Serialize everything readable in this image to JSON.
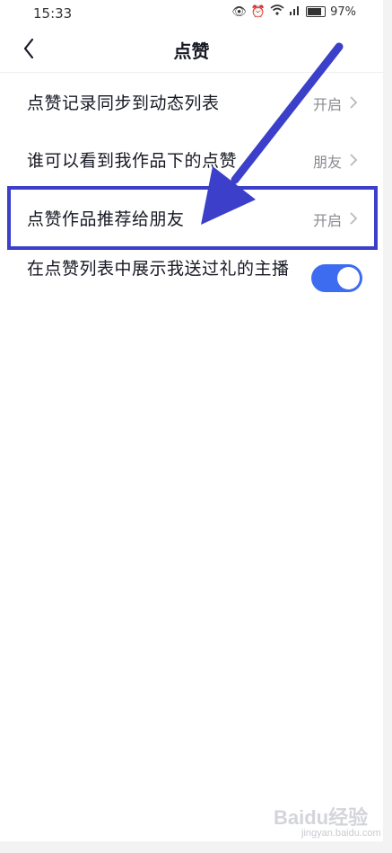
{
  "status_bar": {
    "time": "15:33",
    "battery": "97%"
  },
  "nav": {
    "title": "点赞"
  },
  "settings": [
    {
      "label": "点赞记录同步到动态列表",
      "value": "开启"
    },
    {
      "label": "谁可以看到我作品下的点赞",
      "value": "朋友"
    },
    {
      "label": "点赞作品推荐给朋友",
      "value": "开启"
    },
    {
      "label": "在点赞列表中展示我送过礼的主播",
      "toggle_on": true
    }
  ],
  "watermark": {
    "brand": "Baidu经验",
    "url": "jingyan.baidu.com"
  },
  "colors": {
    "accent": "#3e6cf0",
    "annotation": "#3b3fc9",
    "secondary_text": "#8a8b91"
  }
}
